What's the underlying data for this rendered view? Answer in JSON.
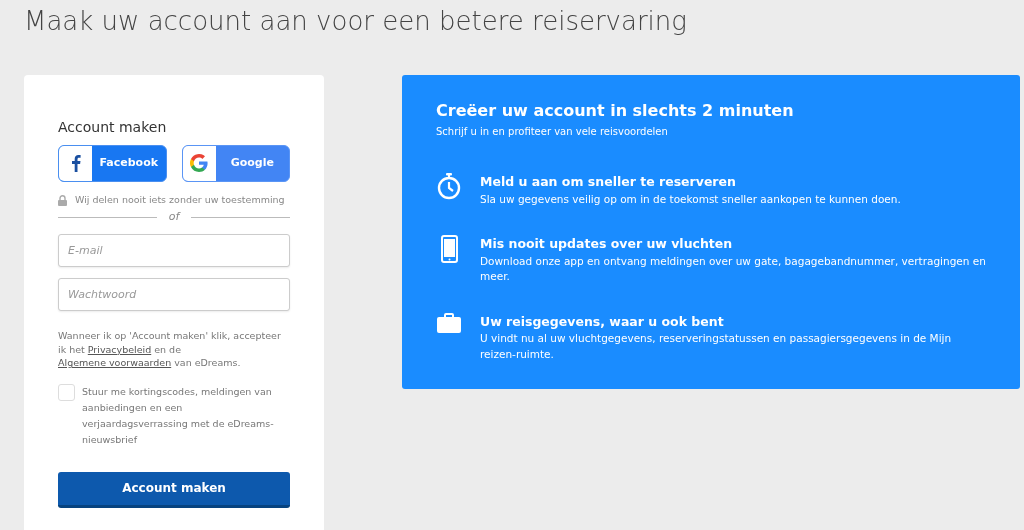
{
  "page_title": "Maak uw account aan voor een betere reiservaring",
  "form": {
    "heading": "Account maken",
    "social_buttons": [
      {
        "kind": "facebook",
        "label": "Facebook"
      },
      {
        "kind": "google",
        "label": "Google"
      }
    ],
    "privacy_note": "Wij delen nooit iets zonder uw toestemming",
    "divider": "of",
    "fields": [
      {
        "placeholder": "E-mail"
      },
      {
        "placeholder": "Wachtwoord"
      }
    ],
    "terms": [
      {
        "kind": "text",
        "text": "Wanneer ik op 'Account maken' klik, accepteer ik het "
      },
      {
        "kind": "link",
        "text": "Privacybeleid"
      },
      {
        "kind": "text",
        "text": " en de "
      },
      {
        "kind": "link",
        "text": "Algemene voorwaarden"
      },
      {
        "kind": "text",
        "text": " van eDreams."
      }
    ],
    "newsletter": {
      "label": "Stuur me kortingscodes, meldingen van aanbiedingen en een verjaardagsverrassing met de eDreams-nieuwsbrief",
      "checked": false
    },
    "submit": "Account maken"
  },
  "promo": {
    "title": "Creëer uw account in slechts 2 minuten",
    "subtitle": "Schrijf u in en profiteer van vele reisvoordelen",
    "benefits": [
      {
        "kind": "stopwatch",
        "title": "Meld u aan om sneller te reserveren",
        "text": "Sla uw gegevens veilig op om in de toekomst sneller aankopen te kunnen doen."
      },
      {
        "kind": "phone",
        "title": "Mis nooit updates over uw vluchten",
        "text": "Download onze app en ontvang meldingen over uw gate, bagagebandnummer, vertragingen en meer."
      },
      {
        "kind": "briefcase",
        "title": "Uw reisgegevens, waar u ook bent",
        "text": "U vindt nu al uw vluchtgegevens, reserveringstatussen en passagiersgegevens in de Mijn reizen-ruimte."
      }
    ]
  }
}
